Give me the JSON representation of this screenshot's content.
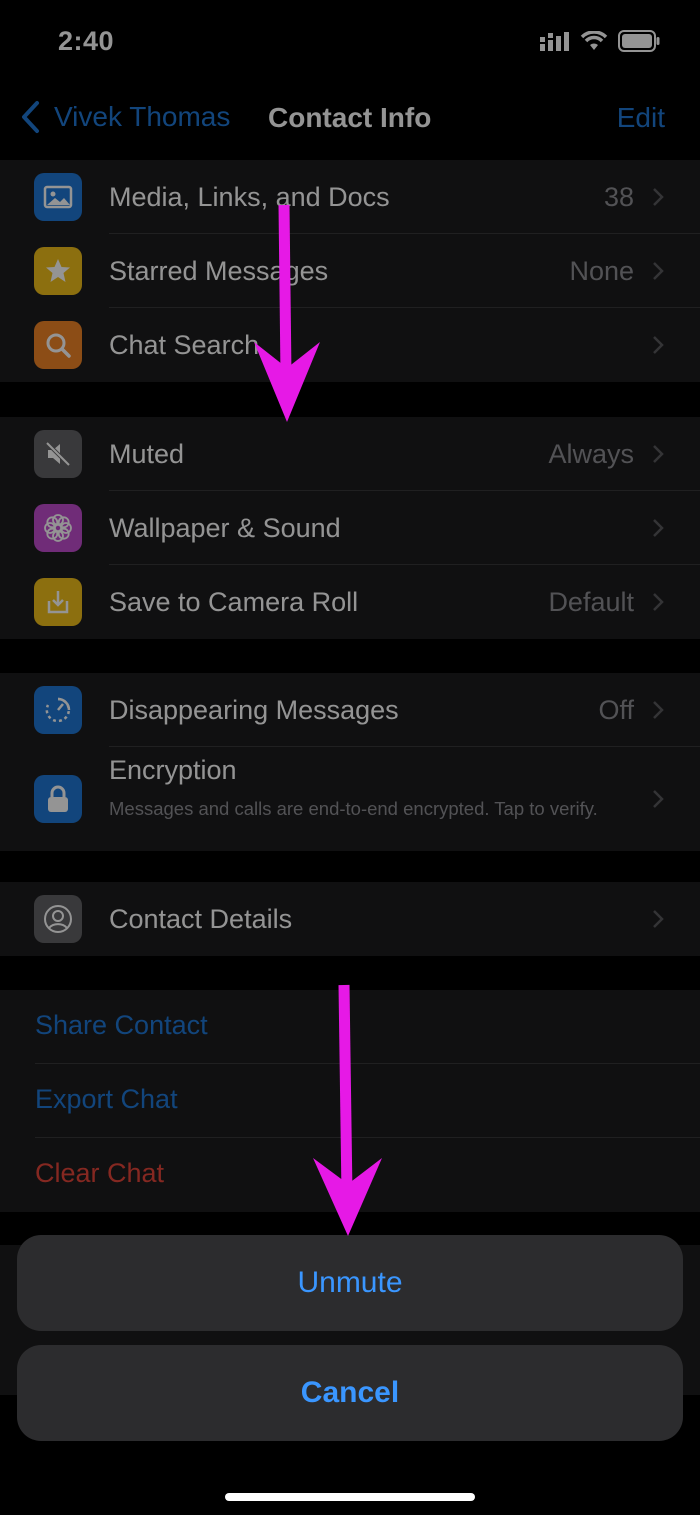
{
  "status_bar": {
    "time": "2:40"
  },
  "navbar": {
    "back_label": "Vivek Thomas",
    "title": "Contact Info",
    "edit_label": "Edit"
  },
  "group1": [
    {
      "label": "Media, Links, and Docs",
      "value": "38",
      "icon": "photo-icon",
      "color": "#1f78d6"
    },
    {
      "label": "Starred Messages",
      "value": "None",
      "icon": "star-icon",
      "color": "#f2c01b"
    },
    {
      "label": "Chat Search",
      "value": "",
      "icon": "search-icon",
      "color": "#f28627"
    }
  ],
  "group2": [
    {
      "label": "Muted",
      "value": "Always",
      "icon": "muted-speaker-icon",
      "color": "#636366"
    },
    {
      "label": "Wallpaper & Sound",
      "value": "",
      "icon": "flower-icon",
      "color": "#c24ccf"
    },
    {
      "label": "Save to Camera Roll",
      "value": "Default",
      "icon": "download-icon",
      "color": "#f2c01b"
    }
  ],
  "group3": [
    {
      "label": "Disappearing Messages",
      "value": "Off",
      "icon": "timer-icon",
      "color": "#1f78d6"
    },
    {
      "label": "Encryption",
      "subtitle": "Messages and calls are end-to-end encrypted. Tap to verify.",
      "icon": "lock-icon",
      "color": "#1f78d6"
    }
  ],
  "group4": [
    {
      "label": "Contact Details",
      "value": "",
      "icon": "person-icon",
      "color": "#636366"
    }
  ],
  "actions": [
    {
      "label": "Share Contact",
      "color": "#1f78d6"
    },
    {
      "label": "Export Chat",
      "color": "#1f78d6"
    },
    {
      "label": "Clear Chat",
      "color": "#e5453a"
    }
  ],
  "sheet": {
    "unmute_label": "Unmute",
    "cancel_label": "Cancel"
  },
  "colors": {
    "accent": "#1f78d6",
    "annotation_arrow": "#e619e6",
    "destructive": "#e5453a"
  }
}
